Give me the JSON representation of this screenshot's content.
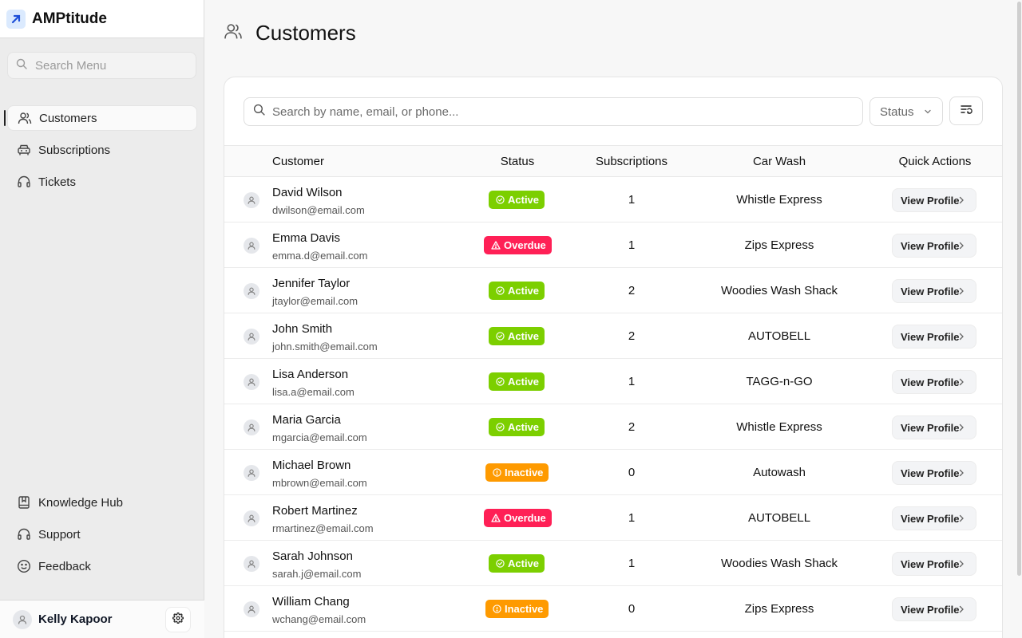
{
  "app": {
    "name": "AMPtitude"
  },
  "sidebar": {
    "search_placeholder": "Search Menu",
    "items": [
      {
        "label": "Customers",
        "icon": "users-icon",
        "active": true
      },
      {
        "label": "Subscriptions",
        "icon": "car-icon",
        "active": false
      },
      {
        "label": "Tickets",
        "icon": "headset-icon",
        "active": false
      }
    ],
    "bottom_items": [
      {
        "label": "Knowledge Hub",
        "icon": "book-icon"
      },
      {
        "label": "Support",
        "icon": "headset-icon"
      },
      {
        "label": "Feedback",
        "icon": "smile-icon"
      }
    ],
    "user": {
      "name": "Kelly Kapoor"
    }
  },
  "header": {
    "title": "Customers"
  },
  "toolbar": {
    "search_placeholder": "Search by name, email, or phone...",
    "status_label": "Status"
  },
  "table": {
    "columns": [
      "Customer",
      "Status",
      "Subscriptions",
      "Car Wash",
      "Quick Actions"
    ],
    "action_label": "View Profile",
    "rows": [
      {
        "name": "David Wilson",
        "email": "dwilson@email.com",
        "status": "Active",
        "subscriptions": "1",
        "car_wash": "Whistle Express"
      },
      {
        "name": "Emma Davis",
        "email": "emma.d@email.com",
        "status": "Overdue",
        "subscriptions": "1",
        "car_wash": "Zips Express"
      },
      {
        "name": "Jennifer Taylor",
        "email": "jtaylor@email.com",
        "status": "Active",
        "subscriptions": "2",
        "car_wash": "Woodies Wash Shack"
      },
      {
        "name": "John Smith",
        "email": "john.smith@email.com",
        "status": "Active",
        "subscriptions": "2",
        "car_wash": "AUTOBELL"
      },
      {
        "name": "Lisa Anderson",
        "email": "lisa.a@email.com",
        "status": "Active",
        "subscriptions": "1",
        "car_wash": "TAGG-n-GO"
      },
      {
        "name": "Maria Garcia",
        "email": "mgarcia@email.com",
        "status": "Active",
        "subscriptions": "2",
        "car_wash": "Whistle Express"
      },
      {
        "name": "Michael Brown",
        "email": "mbrown@email.com",
        "status": "Inactive",
        "subscriptions": "0",
        "car_wash": "Autowash"
      },
      {
        "name": "Robert Martinez",
        "email": "rmartinez@email.com",
        "status": "Overdue",
        "subscriptions": "1",
        "car_wash": "AUTOBELL"
      },
      {
        "name": "Sarah Johnson",
        "email": "sarah.j@email.com",
        "status": "Active",
        "subscriptions": "1",
        "car_wash": "Woodies Wash Shack"
      },
      {
        "name": "William Chang",
        "email": "wchang@email.com",
        "status": "Inactive",
        "subscriptions": "0",
        "car_wash": "Zips Express"
      }
    ]
  },
  "status_colors": {
    "Active": "#7ccf00",
    "Overdue": "#ff2056",
    "Inactive": "#fe9a00"
  },
  "status_icons": {
    "Active": "check-circle-icon",
    "Overdue": "alert-triangle-icon",
    "Inactive": "alert-circle-icon"
  }
}
